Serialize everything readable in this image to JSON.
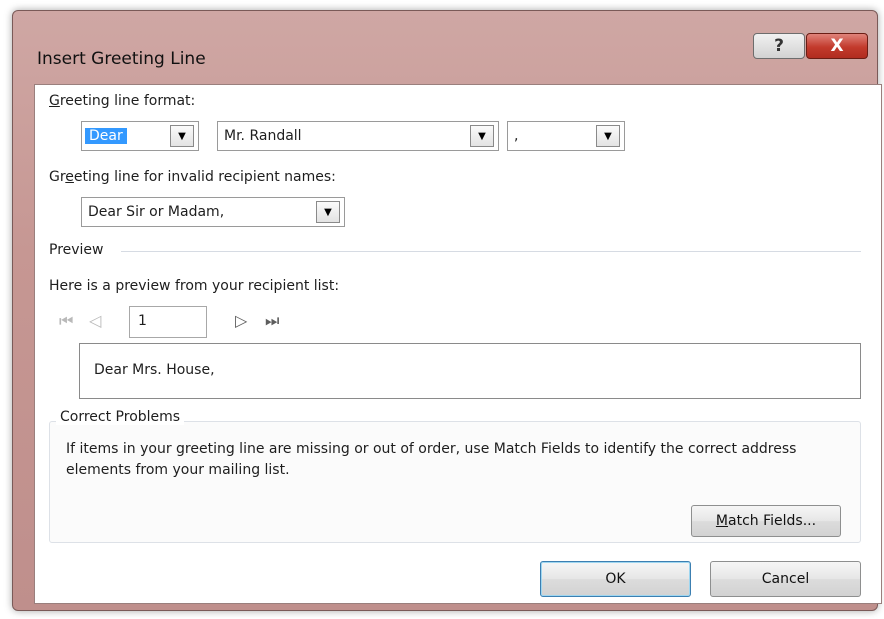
{
  "window": {
    "title": "Insert Greeting Line",
    "help_label": "?",
    "close_label": "X"
  },
  "greeting_format": {
    "label_accel": "G",
    "label_rest": "reeting line format:",
    "salutation": "Dear",
    "name_format": "Mr. Randall",
    "punctuation": ","
  },
  "invalid_names": {
    "label_pre": "Gr",
    "label_accel": "e",
    "label_rest": "eting line for invalid recipient names:",
    "value": "Dear Sir or Madam,"
  },
  "preview": {
    "section_label": "Preview",
    "intro": "Here is a preview from your recipient list:",
    "record_number": "1",
    "preview_text": "Dear Mrs. House,"
  },
  "nav": {
    "first_icon": "first-record-icon",
    "prev_icon": "previous-record-icon",
    "next_icon": "next-record-icon",
    "last_icon": "last-record-icon",
    "first_glyph": "⏮",
    "prev_glyph": "◁",
    "next_glyph": "▷",
    "last_glyph": "⏭"
  },
  "correct_problems": {
    "legend": "Correct Problems",
    "text": "If items in your greeting line are missing or out of order, use Match Fields to identify the correct address elements from your mailing list.",
    "match_accel": "M",
    "match_rest": "atch Fields..."
  },
  "footer": {
    "ok_label": "OK",
    "cancel_label": "Cancel"
  },
  "colors": {
    "selection": "#3399ff",
    "frame": "#c69793",
    "close_button": "#c23a2c"
  }
}
